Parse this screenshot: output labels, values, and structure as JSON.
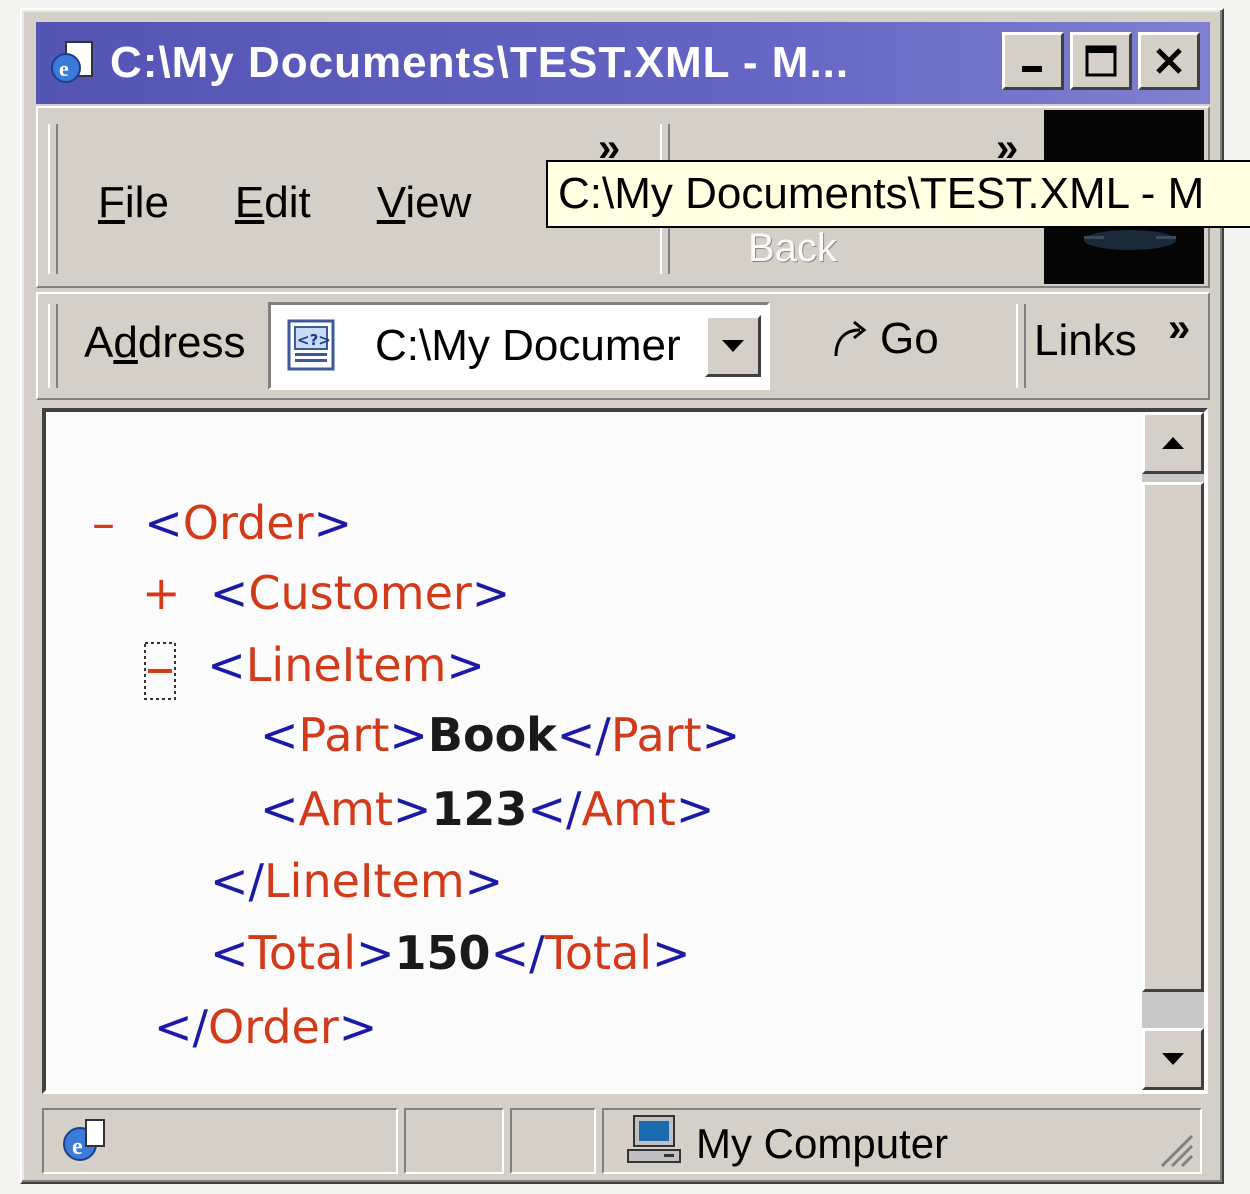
{
  "window": {
    "title": "C:\\My Documents\\TEST.XML - M..."
  },
  "tooltip": "C:\\My Documents\\TEST.XML - M",
  "menu": {
    "file": "File",
    "edit": "Edit",
    "view": "View"
  },
  "toolbar": {
    "back_label": "Back"
  },
  "address": {
    "label": "Address",
    "value": "C:\\My Documer",
    "go_label": "Go",
    "links_label": "Links"
  },
  "xml": {
    "order_collapse_marker": "–",
    "order_open": "Order",
    "customer_expand_marker": "+",
    "customer_open": "Customer",
    "lineitem_open": "LineItem",
    "part_tag": "Part",
    "part_value": "Book",
    "amt_tag": "Amt",
    "amt_value": "123",
    "lineitem_close": "LineItem",
    "total_tag": "Total",
    "total_value": "150",
    "order_close": "Order"
  },
  "status": {
    "zone": "My Computer"
  }
}
